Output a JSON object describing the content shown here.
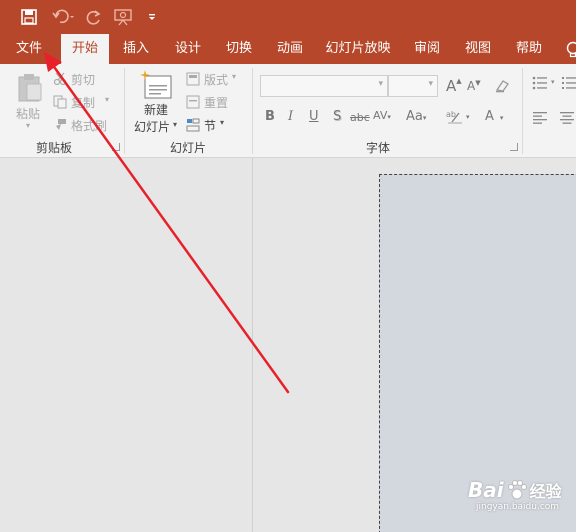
{
  "quick_access": {
    "icons": [
      "save-icon",
      "undo-icon",
      "redo-icon",
      "start-from-beginning-icon",
      "customize-quick-access-icon"
    ]
  },
  "tabs": [
    "文件",
    "开始",
    "插入",
    "设计",
    "切换",
    "动画",
    "幻灯片放映",
    "审阅",
    "视图",
    "帮助"
  ],
  "clipboard": {
    "paste_label": "粘贴",
    "cut_label": "剪切",
    "copy_label": "复制",
    "format_painter_label": "格式刷",
    "group_label": "剪贴板"
  },
  "slides": {
    "new_slide_line1": "新建",
    "new_slide_line2": "幻灯片",
    "layout_label": "版式",
    "reset_label": "重置",
    "section_label": "节",
    "group_label": "幻灯片"
  },
  "font": {
    "group_label": "字体",
    "font_name_value": "",
    "font_size_value": "",
    "grow_label": "A",
    "shrink_label": "A",
    "bold_label": "B",
    "italic_label": "I",
    "underline_label": "U",
    "shadow_label": "S",
    "strike_label": "abc",
    "spacing_label": "AV",
    "case_label": "Aa",
    "color_label": "A"
  },
  "watermark": {
    "brand": "Bai",
    "brand2": "经验",
    "url": "jingyan.baidu.com"
  },
  "colors": {
    "accent": "#b7472a",
    "arrow": "#e8202a",
    "slide": "#d3d7de",
    "ribbon": "#f3f3f3"
  }
}
